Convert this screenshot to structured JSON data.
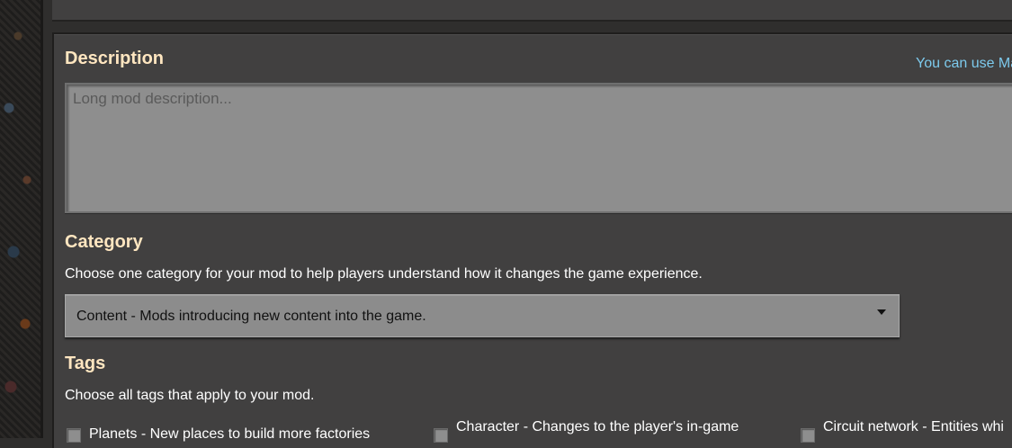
{
  "description": {
    "heading": "Description",
    "markdown_hint": "You can use Ma",
    "placeholder": "Long mod description..."
  },
  "category": {
    "heading": "Category",
    "help": "Choose one category for your mod to help players understand how it changes the game experience.",
    "selected": "Content - Mods introducing new content into the game."
  },
  "tags": {
    "heading": "Tags",
    "help": "Choose all tags that apply to your mod.",
    "items": [
      {
        "label": "Planets - New places to build more factories"
      },
      {
        "label": "Character - Changes to the player's in-game"
      },
      {
        "label": "Circuit network - Entities whi"
      }
    ]
  }
}
